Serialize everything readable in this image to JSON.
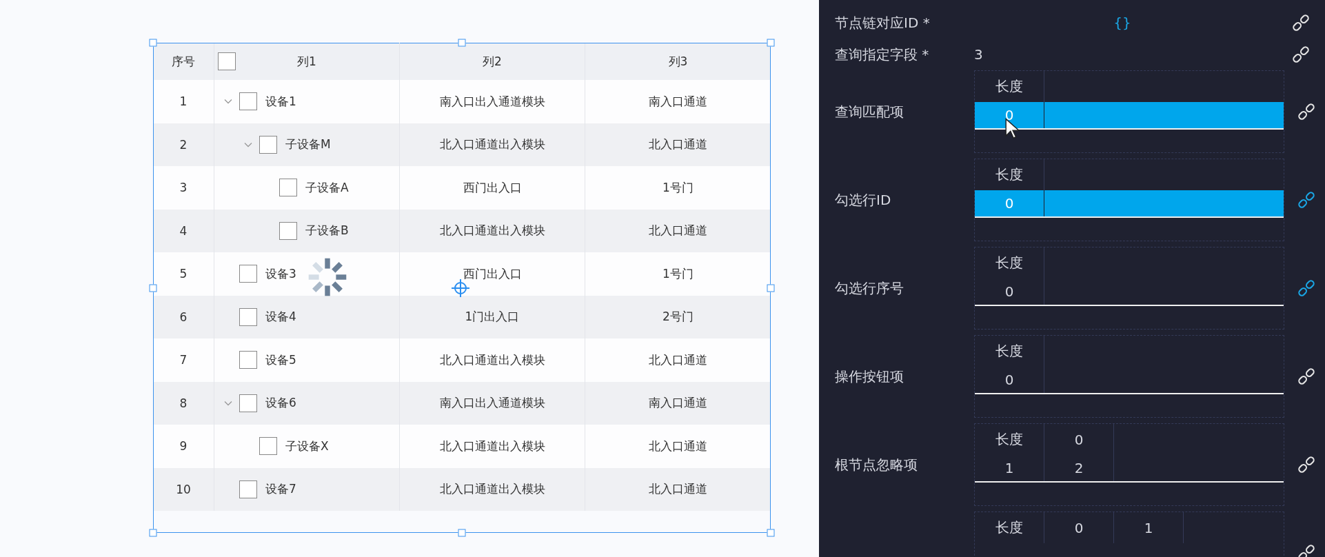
{
  "table": {
    "columns": [
      {
        "label": "序号"
      },
      {
        "label": "列1"
      },
      {
        "label": "列2"
      },
      {
        "label": "列3"
      }
    ],
    "header_checked": false,
    "rows": [
      {
        "index": "1",
        "name": "设备1",
        "checked": false,
        "expanded": true,
        "cells": [
          "南入口出入通道模块",
          "南入口通道"
        ],
        "children": [
          {
            "index": "2",
            "name": "子设备M",
            "checked": false,
            "expanded": true,
            "cells": [
              "北入口通道出入模块",
              "北入口通道"
            ],
            "children": [
              {
                "index": "3",
                "name": "子设备A",
                "checked": false,
                "cells": [
                  "西门出入口",
                  "1号门"
                ]
              },
              {
                "index": "4",
                "name": "子设备B",
                "checked": false,
                "cells": [
                  "北入口通道出入模块",
                  "北入口通道"
                ]
              }
            ]
          }
        ]
      },
      {
        "index": "5",
        "name": "设备3",
        "checked": false,
        "cells": [
          "西门出入口",
          "1号门"
        ]
      },
      {
        "index": "6",
        "name": "设备4",
        "checked": false,
        "cells": [
          "1门出入口",
          "2号门"
        ]
      },
      {
        "index": "7",
        "name": "设备5",
        "checked": false,
        "cells": [
          "北入口通道出入模块",
          "北入口通道"
        ]
      },
      {
        "index": "8",
        "name": "设备6",
        "checked": false,
        "expanded": true,
        "cells": [
          "南入口出入通道模块",
          "南入口通道"
        ],
        "children": [
          {
            "index": "9",
            "name": "子设备X",
            "checked": false,
            "cells": [
              "北入口通道出入模块",
              "北入口通道"
            ]
          }
        ]
      },
      {
        "index": "10",
        "name": "设备7",
        "checked": false,
        "cells": [
          "北入口通道出入模块",
          "北入口通道"
        ]
      }
    ]
  },
  "properties": [
    {
      "kind": "expression",
      "label": "节点链对应ID *",
      "value": "{}",
      "linked": false
    },
    {
      "kind": "text",
      "label": "查询指定字段 *",
      "value": "3",
      "linked": false
    },
    {
      "kind": "array",
      "label": "查询匹配项",
      "rows": [
        [
          "长度"
        ],
        [
          "0"
        ]
      ],
      "highlighted": true,
      "linked": false
    },
    {
      "kind": "array",
      "label": "勾选行ID",
      "rows": [
        [
          "长度"
        ],
        [
          "0"
        ]
      ],
      "highlighted": true,
      "linked": true
    },
    {
      "kind": "array",
      "label": "勾选行序号",
      "rows": [
        [
          "长度"
        ],
        [
          "0"
        ]
      ],
      "highlighted": false,
      "linked": true
    },
    {
      "kind": "array",
      "label": "操作按钮项",
      "rows": [
        [
          "长度"
        ],
        [
          "0"
        ]
      ],
      "highlighted": false,
      "linked": false
    },
    {
      "kind": "array",
      "label": "根节点忽略项",
      "rows": [
        [
          "长度",
          "0"
        ],
        [
          "1",
          "2"
        ]
      ],
      "highlighted": false,
      "linked": false
    },
    {
      "kind": "array",
      "rows": [
        [
          "长度",
          "0",
          "1"
        ]
      ],
      "highlighted": false,
      "linked": false
    }
  ]
}
